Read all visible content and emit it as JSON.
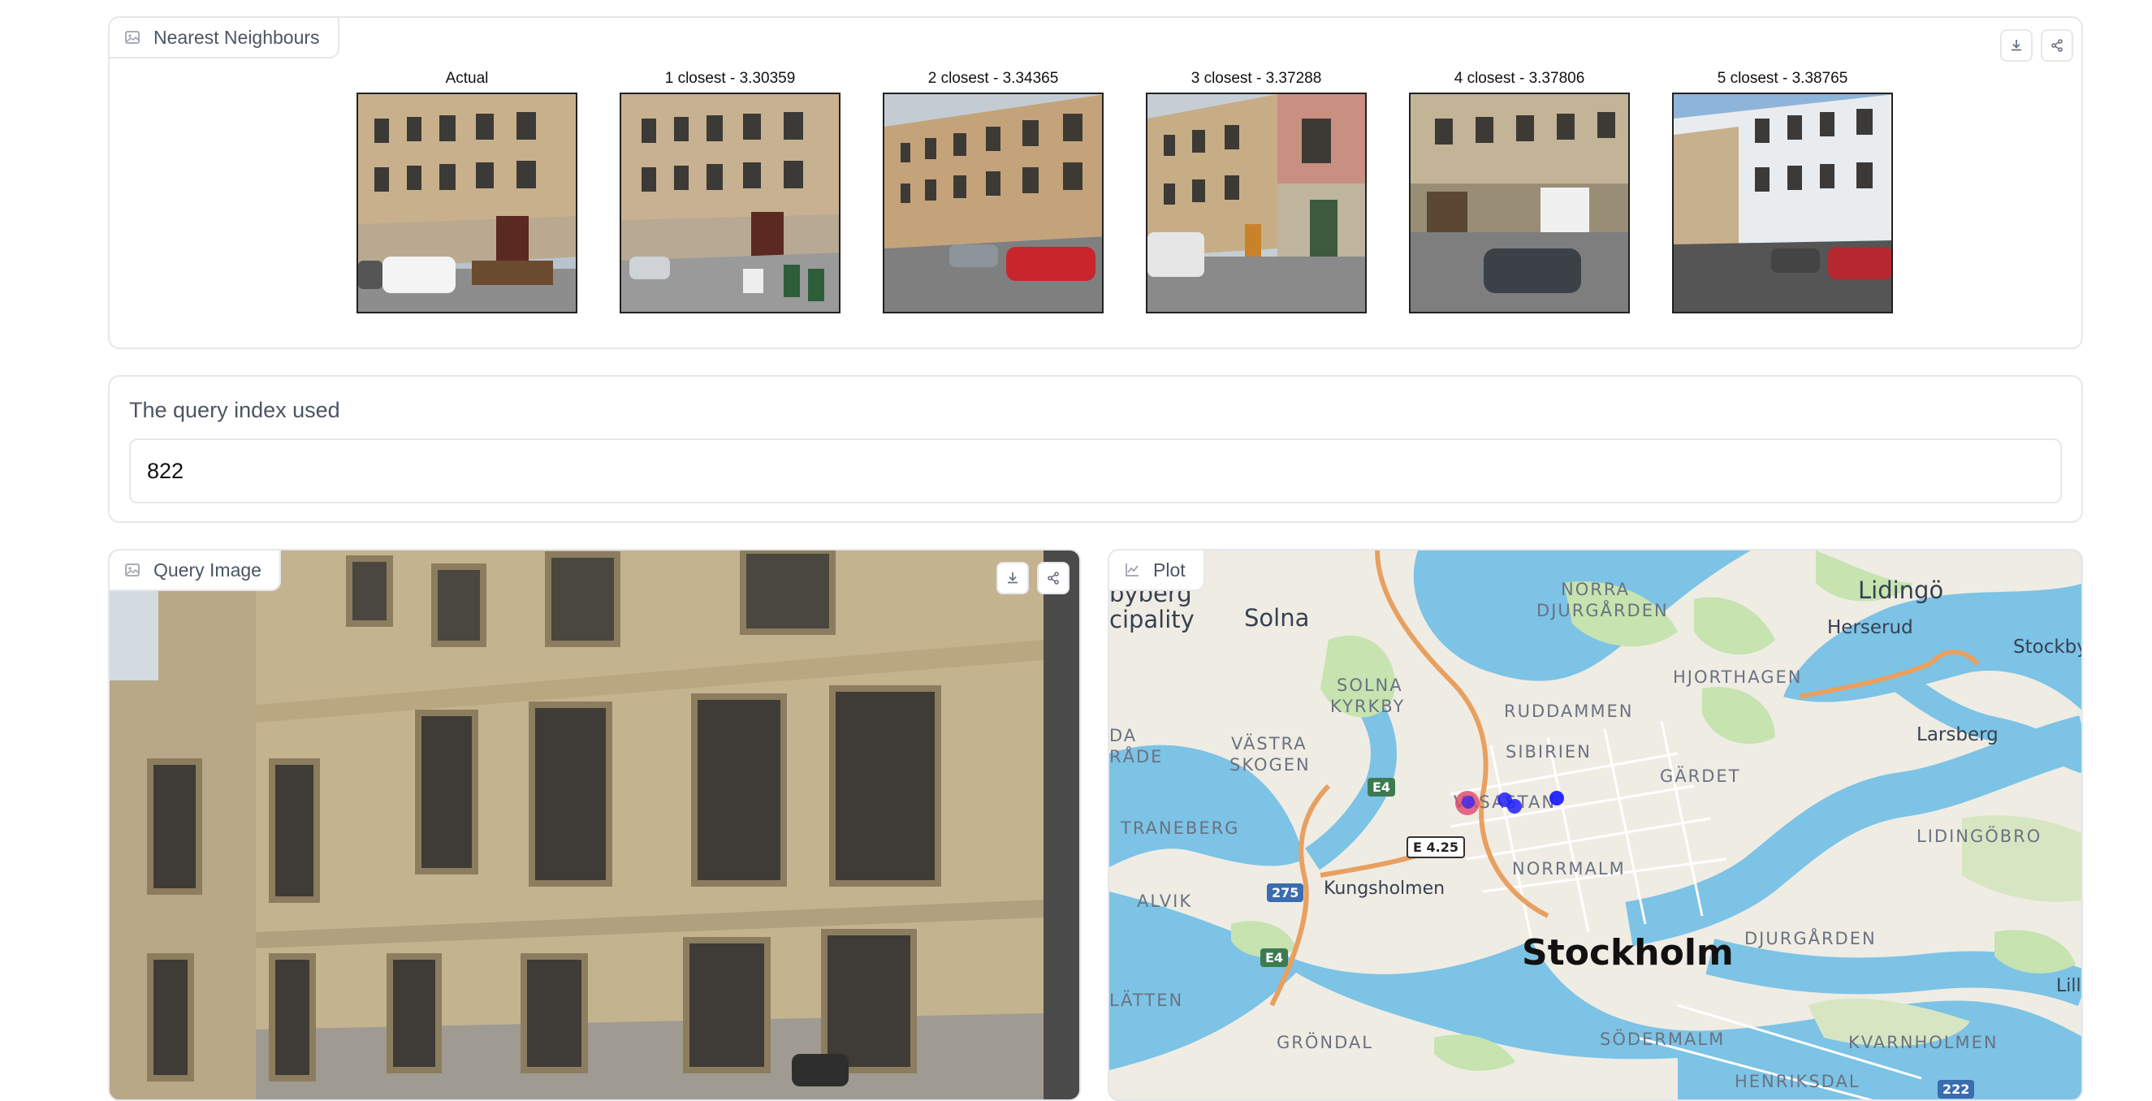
{
  "gallery": {
    "label": "Nearest Neighbours",
    "icon": "image-icon",
    "buttons": [
      "download-icon",
      "share-icon"
    ],
    "items": [
      {
        "caption": "Actual"
      },
      {
        "caption": "1 closest - 3.30359"
      },
      {
        "caption": "2 closest - 3.34365"
      },
      {
        "caption": "3 closest - 3.37288"
      },
      {
        "caption": "4 closest - 3.37806"
      },
      {
        "caption": "5 closest - 3.38765"
      }
    ]
  },
  "query_index": {
    "label": "The query index used",
    "value": "822"
  },
  "query_image": {
    "label": "Query Image",
    "icon": "image-icon",
    "buttons": [
      "download-icon",
      "share-icon"
    ]
  },
  "plot": {
    "label": "Plot",
    "icon": "chart-icon",
    "marker_colors": {
      "actual": "#e0476a",
      "neighbour": "#1f1fff"
    },
    "place_labels": {
      "solna": "Solna",
      "cipality": "cipality",
      "byberg": "byberg",
      "lidingo": "Lidingö",
      "herserud": "Herserud",
      "stockby": "Stockby",
      "norra_djurgarden_1": "NORRA",
      "norra_djurgarden_2": "DJURGÅRDEN",
      "hjorthagen": "HJORTHAGEN",
      "solna_kyrkby_1": "SOLNA",
      "solna_kyrkby_2": "KYRKBY",
      "ruddammen": "RUDDAMMEN",
      "larsberg": "Larsberg",
      "da": "DA",
      "rade": "RÅDE",
      "vastra_skogen_1": "VÄSTRA",
      "vastra_skogen_2": "SKOGEN",
      "sibirien": "SIBIRIEN",
      "gardet": "GÄRDET",
      "vasastan": "VASASTAN",
      "traneberg": "TRANEBERG",
      "lidingobro": "LIDINGÖBRO",
      "kungsholmen": "Kungsholmen",
      "norrmalm": "NORRMALM",
      "alvik": "ALVIK",
      "stockholm": "Stockholm",
      "djurgarden": "DJURGÅRDEN",
      "latten": "LÄTTEN",
      "lilla": "Lilla",
      "grondal": "GRÖNDAL",
      "sodermalm": "SÖDERMALM",
      "kvarnholmen": "KVARNHOLMEN",
      "henriksdal": "HENRIKSDAL"
    },
    "road_signs": {
      "e4_a": "E4",
      "e425": "E 4.25",
      "r275": "275",
      "e4_b": "E4",
      "r222": "222"
    }
  }
}
